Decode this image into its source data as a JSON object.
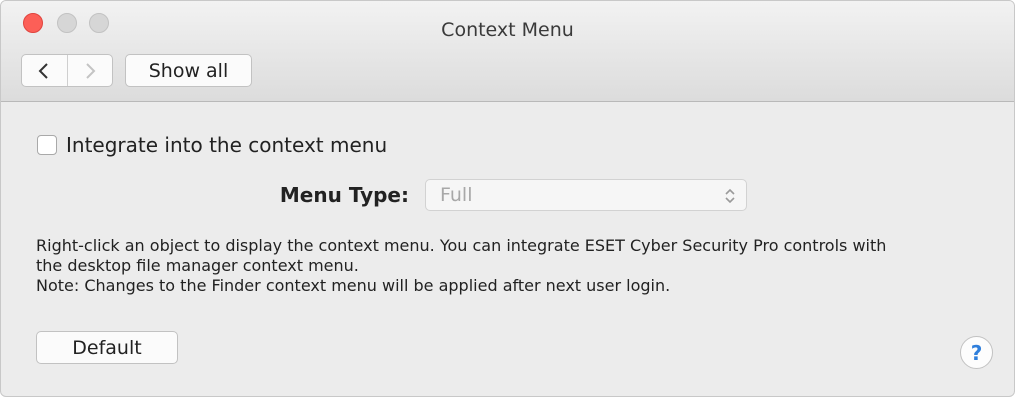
{
  "window": {
    "title": "Context Menu"
  },
  "toolbar": {
    "back_icon": "chevron-left-icon",
    "forward_icon": "chevron-right-icon",
    "show_all_label": "Show all"
  },
  "settings": {
    "integrate_label": "Integrate into the context menu",
    "integrate_checked": false,
    "menu_type_label": "Menu Type:",
    "menu_type_value": "Full"
  },
  "description": {
    "line1": "Right-click an object to display the context menu. You can integrate ESET Cyber Security Pro controls with",
    "line2": "the desktop file manager context menu.",
    "line3": "Note: Changes to the Finder context menu will be applied after next user login."
  },
  "footer": {
    "default_label": "Default",
    "help_label": "?"
  },
  "colors": {
    "close": "#fc5f57",
    "accent": "#2f7fdc"
  }
}
